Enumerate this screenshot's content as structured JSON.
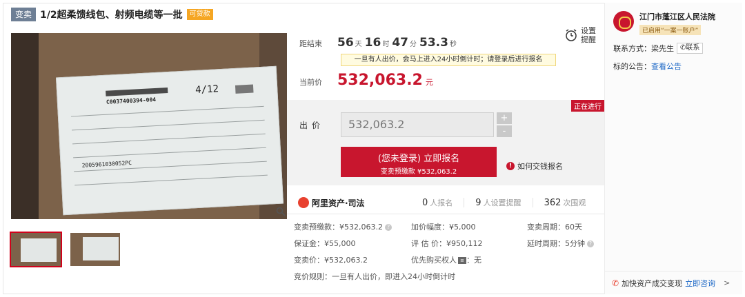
{
  "title": {
    "type_tag": "变卖",
    "text": "1/2超柔馈线包、射频电缆等一批",
    "loan_tag": "可贷款"
  },
  "countdown": {
    "label": "距结束",
    "days": "56",
    "days_unit": "天",
    "hours": "16",
    "hours_unit": "时",
    "minutes": "47",
    "minutes_unit": "分",
    "seconds": "53.3",
    "seconds_unit": "秒"
  },
  "remind": {
    "line1": "设置",
    "line2": "提醒"
  },
  "notice": "一旦有人出价，会马上进入24小时倒计时；请登录后进行报名",
  "current_price": {
    "label": "当前价",
    "value": "532,063.2",
    "unit": "元"
  },
  "bid": {
    "status_badge": "正在进行",
    "label": "出价",
    "input_value": "532,063.2",
    "plus": "+",
    "minus": "-",
    "signup_line1": "(您未登录) 立即报名",
    "signup_line2": "变卖预缴款 ¥532,063.2",
    "howto": "如何交钱报名"
  },
  "stats": {
    "brand": "阿里资产·司法",
    "signups_num": "0",
    "signups_label": "人报名",
    "reminders_num": "9",
    "reminders_label": "人设置提醒",
    "views_num": "362",
    "views_label": "次围观"
  },
  "info": {
    "deposit": "变卖预缴款：¥532,063.2",
    "increment": "加价幅度：¥5,000",
    "period": "变卖周期：60天",
    "guarantee": "保证金：¥55,000",
    "appraisal": "评 估 价：¥950,112",
    "delay": "延时周期：5分钟",
    "sale_price": "变卖价：¥532,063.2",
    "priority": "优先购买权人",
    "priority_value": "：无",
    "rule": "竞价规则：一旦有人出价，即进入24小时倒计时"
  },
  "sidebar": {
    "court_name": "江门市蓬江区人民法院",
    "court_tag": "已启用“一案一账户”",
    "contact_label": "联系方式：梁先生",
    "contact_btn": "联系",
    "notice_label": "标的公告：",
    "notice_link": "查看公告",
    "consult_text": "加快资产成交变现",
    "consult_link": "立即咨询",
    "consult_chev": ">"
  },
  "image_label_text": {
    "code": "C0037400394-004",
    "fraction": "4/12",
    "serial": "2005961030052PC"
  },
  "colors": {
    "accent": "#c8162e",
    "link": "#1a66c6",
    "type_tag": "#6e7f95",
    "loan_tag": "#f5a623"
  }
}
